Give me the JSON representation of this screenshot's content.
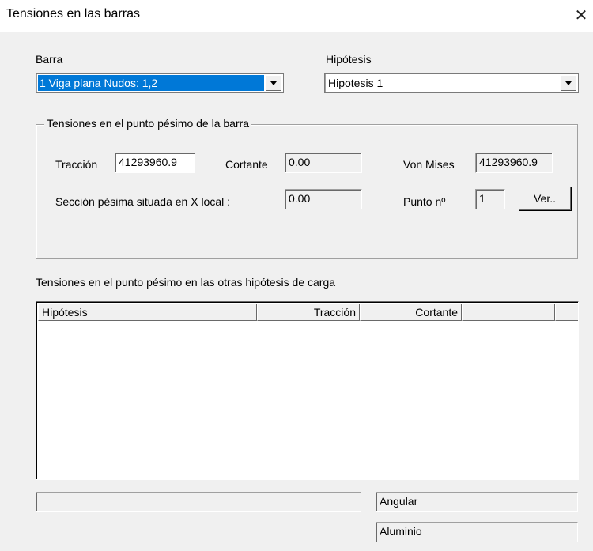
{
  "window": {
    "title": "Tensiones en las barras",
    "close_glyph": "✕"
  },
  "barra": {
    "label": "Barra",
    "selected": "1  Viga plana   Nudos: 1,2"
  },
  "hipotesis": {
    "label": "Hipótesis",
    "selected": "Hipotesis 1"
  },
  "group": {
    "legend": "Tensiones en el punto pésimo de la barra",
    "traccion_label": "Tracción",
    "traccion_value": "41293960.9",
    "cortante_label": "Cortante",
    "cortante_value": "0.00",
    "vonmises_label": "Von Mises",
    "vonmises_value": "41293960.9",
    "seccion_label": "Sección pésima situada en X local :",
    "seccion_value": "0.00",
    "punto_label": "Punto nº",
    "punto_value": "1",
    "ver_button": "Ver.."
  },
  "otras": {
    "label": "Tensiones en el punto pésimo en las otras hipótesis de carga",
    "columns": [
      "Hipótesis",
      "Tracción",
      "Cortante",
      ""
    ]
  },
  "status": {
    "left": "",
    "perfil": "Angular",
    "material": "Aluminio"
  }
}
